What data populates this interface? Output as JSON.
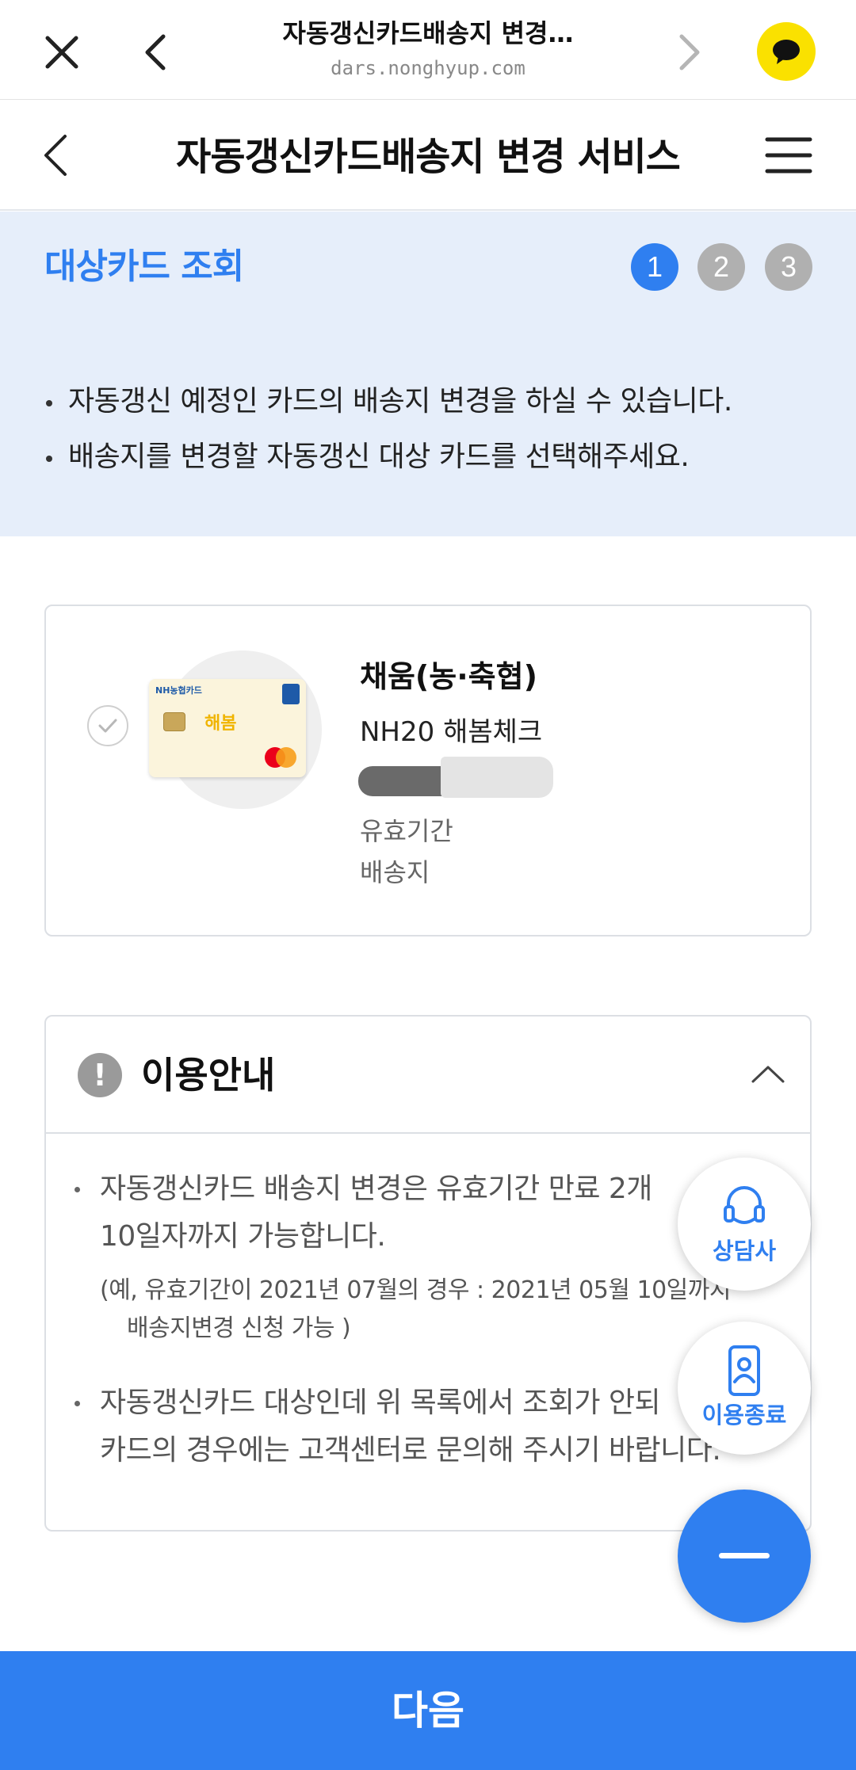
{
  "browser": {
    "title": "자동갱신카드배송지 변경…",
    "url": "dars.nonghyup.com"
  },
  "header": {
    "title": "자동갱신카드배송지 변경 서비스"
  },
  "step": {
    "title": "대상카드 조회",
    "steps": [
      "1",
      "2",
      "3"
    ],
    "current": 1,
    "bullets": [
      "자동갱신 예정인 카드의 배송지 변경을 하실 수 있습니다.",
      "배송지를 변경할 자동갱신 대상 카드를 선택해주세요."
    ]
  },
  "card": {
    "name": "채움(농·축협)",
    "product": "NH20 해봄체크",
    "validity_label": "유효기간",
    "address_label": "배송지",
    "image": {
      "issuer_text": "NH농협카드",
      "brand_text": "해봄"
    }
  },
  "notice": {
    "title": "이용안내",
    "items": [
      {
        "lines": [
          "자동갱신카드 배송지 변경은 유효기간 만료 2개",
          "10일자까지 가능합니다."
        ],
        "sub": [
          "(예, 유효기간이 2021년 07월의 경우 : 2021년 05월 10일까지",
          "배송지변경 신청 가능 )"
        ]
      },
      {
        "lines": [
          "자동갱신카드 대상인데 위 목록에서 조회가 안되",
          "카드의 경우에는 고객센터로 문의해 주시기 바랍니다."
        ]
      }
    ]
  },
  "fabs": {
    "counsel_label": "상담사",
    "exit_label": "이용종료"
  },
  "next_button": {
    "label": "다음"
  },
  "colors": {
    "accent": "#2f7ff0",
    "step_bg": "#e6eefa",
    "step_inactive": "#b0b0b0",
    "kakao_yellow": "#fae100"
  },
  "icons": {
    "browser_close": "close-icon",
    "browser_back": "chevron-left-icon",
    "browser_forward": "chevron-right-icon",
    "kakao": "kakaotalk-icon",
    "header_back": "chevron-left-icon",
    "menu": "hamburger-menu-icon",
    "card_select": "check-circle-icon",
    "notice": "exclamation-circle-icon",
    "toggle": "chevron-up-icon",
    "counsel": "headset-icon",
    "exit": "mobile-person-icon",
    "collapse": "minus-icon"
  }
}
